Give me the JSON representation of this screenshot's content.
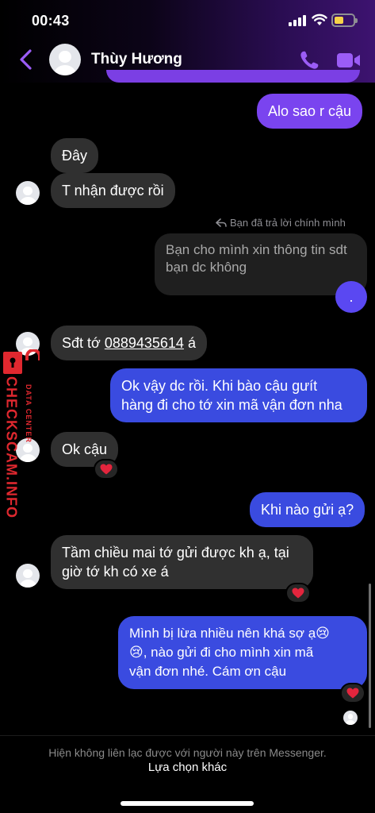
{
  "status_bar": {
    "time": "00:43"
  },
  "header": {
    "contact_name": "Thùy Hương",
    "icons": [
      "back-chevron-icon",
      "phone-call-icon",
      "video-call-icon"
    ],
    "accent_color": "#9b5cf6"
  },
  "messages": {
    "m1": "Alo sao r cậu",
    "m2": "Đây",
    "m3": "T nhận được rồi",
    "reply_label": "Bạn đã trả lời chính mình",
    "m4_quoted": "Bạn cho mình xin thông tin sdt\nbạn dc không",
    "m4_reply": ".",
    "m5_prefix": "Sđt tớ ",
    "m5_phone": "0889435614",
    "m5_suffix": " á",
    "m6_line1": "Ok vậy dc rồi. Khi bào cậu gưít",
    "m6_line2": "hàng đi cho tớ xin mã vận đơn nha",
    "m7": "Ok cậu",
    "m8": "Khi nào gửi ạ?",
    "m9_line1": "Tầm chiều mai tớ gửi được kh ạ, tại",
    "m9_line2": "giờ tớ kh có xe á",
    "m10_line1": "Mình bị lừa nhiều nên khá sợ ạ😢",
    "m10_line2": "😢, nào gửi đi cho mình xin mã",
    "m10_line3": "vận đơn nhé. Cám ơn cậu",
    "reaction": "heart"
  },
  "footer": {
    "notice": "Hiện không liên lạc được với người này trên Messenger.",
    "action": "Lựa chọn khác"
  },
  "watermark": {
    "brand": "CHECKSCAM.INFO",
    "sub": "DATA CENTER"
  },
  "colors": {
    "incoming_bubble": "#303030",
    "outgoing_purple": "#7a44ef",
    "outgoing_blue": "#3a4be0",
    "watermark_red": "#e0282f"
  }
}
